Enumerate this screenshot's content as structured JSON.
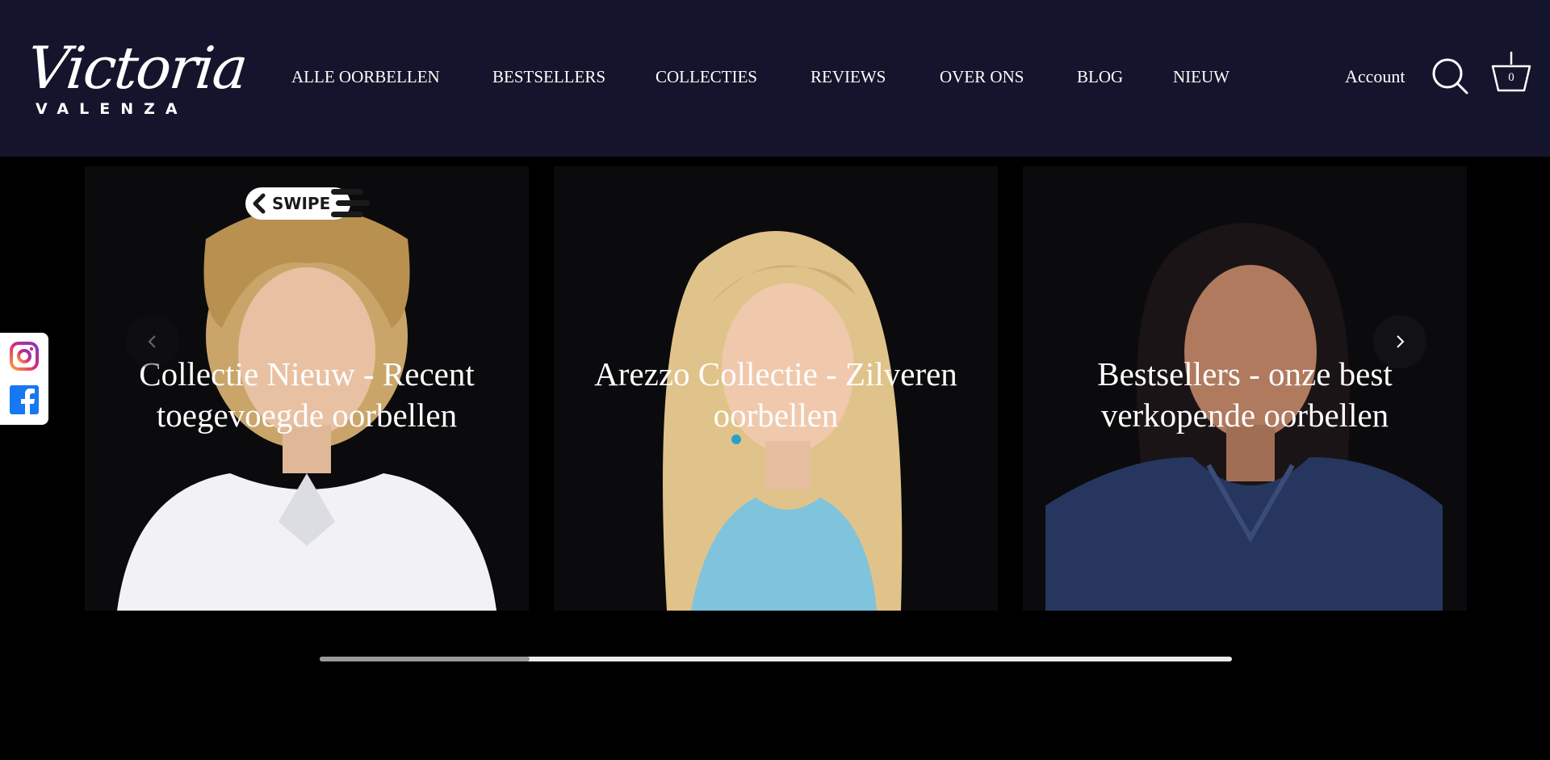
{
  "header": {
    "logo": {
      "script": "Victoria",
      "sub": "VALENZA"
    },
    "nav": [
      {
        "label": "ALLE OORBELLEN"
      },
      {
        "label": "BESTSELLERS"
      },
      {
        "label": "COLLECTIES"
      },
      {
        "label": "REVIEWS"
      },
      {
        "label": "OVER ONS"
      },
      {
        "label": "BLOG"
      },
      {
        "label": "NIEUW"
      }
    ],
    "account_label": "Account",
    "search_icon": "search-icon",
    "cart_icon": "cart-icon",
    "cart_count": "0",
    "colors": {
      "header_bg": "#14152c",
      "text": "#ffffff"
    }
  },
  "slider": {
    "swipe_label": "SWIPE",
    "cards": [
      {
        "title": "Collectie Nieuw - Recent toegevoegde oorbellen",
        "shirt_color": "#f2f2f4",
        "hair_color": "#c9a56a"
      },
      {
        "title": "Arezzo Collectie - Zilveren oorbellen",
        "shirt_color": "#7fc3dd",
        "hair_color": "#e0c38a"
      },
      {
        "title": "Bestsellers - onze best verkopende oorbellen",
        "shirt_color": "#26365e",
        "hair_color": "#1a1416"
      }
    ],
    "prev_icon": "chevron-left-icon",
    "next_icon": "chevron-right-icon",
    "scroll_progress": 0.23
  },
  "social": {
    "instagram_icon": "instagram-icon",
    "facebook_icon": "facebook-icon"
  }
}
